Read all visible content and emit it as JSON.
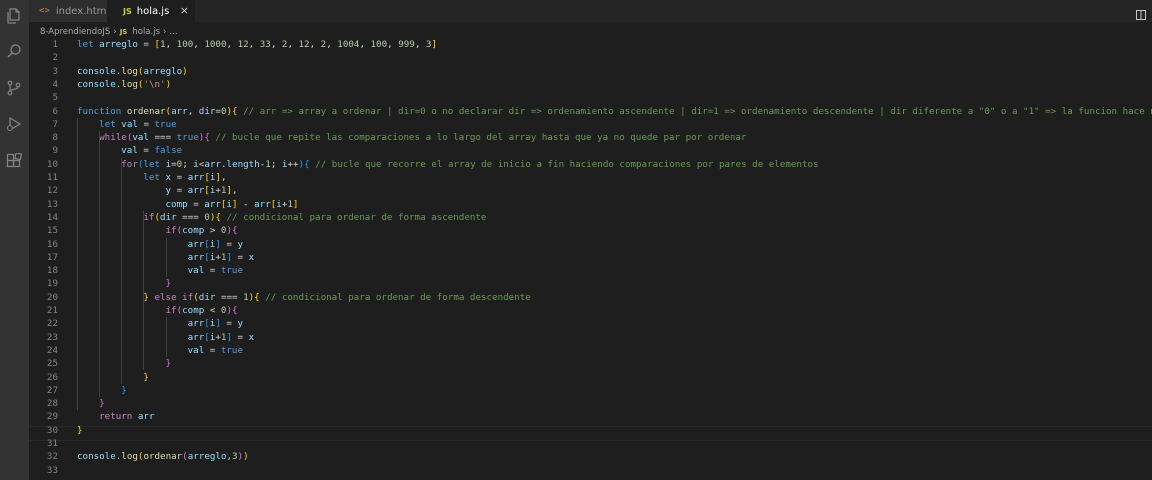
{
  "tabs": [
    {
      "label": "index.html",
      "icon": "html-file-icon"
    },
    {
      "label": "hola.js",
      "icon": "js-file-icon",
      "close": "×"
    }
  ],
  "breadcrumb": {
    "folder": "8-AprendiendoJS",
    "file": "hola.js",
    "symbol": "..."
  },
  "icon_glyphs": {
    "html": "<>",
    "js": "JS"
  },
  "colors": {
    "keyword": "#569cd6",
    "control": "#c586c0",
    "function": "#dcdcaa",
    "variable": "#9cdcfe",
    "number": "#b5cea8",
    "string": "#ce9178",
    "comment": "#6a9955",
    "editor_bg": "#1e1e1e",
    "activity_bg": "#333333"
  },
  "editor": {
    "line_numbers": [
      "1",
      "2",
      "3",
      "4",
      "5",
      "6",
      "7",
      "8",
      "9",
      "10",
      "11",
      "12",
      "13",
      "14",
      "15",
      "16",
      "17",
      "18",
      "19",
      "20",
      "21",
      "22",
      "23",
      "24",
      "25",
      "26",
      "27",
      "28",
      "29",
      "30",
      "31",
      "32",
      "33"
    ],
    "lines": [
      [
        [
          "k",
          "let"
        ],
        [
          "p",
          " "
        ],
        [
          "v",
          "arreglo"
        ],
        [
          "p",
          " = "
        ],
        [
          "b1",
          "["
        ],
        [
          "n",
          "1"
        ],
        [
          "p",
          ", "
        ],
        [
          "n",
          "100"
        ],
        [
          "p",
          ", "
        ],
        [
          "n",
          "1000"
        ],
        [
          "p",
          ", "
        ],
        [
          "n",
          "12"
        ],
        [
          "p",
          ", "
        ],
        [
          "n",
          "33"
        ],
        [
          "p",
          ", "
        ],
        [
          "n",
          "2"
        ],
        [
          "p",
          ", "
        ],
        [
          "n",
          "12"
        ],
        [
          "p",
          ", "
        ],
        [
          "n",
          "2"
        ],
        [
          "p",
          ", "
        ],
        [
          "n",
          "1004"
        ],
        [
          "p",
          ", "
        ],
        [
          "n",
          "100"
        ],
        [
          "p",
          ", "
        ],
        [
          "n",
          "999"
        ],
        [
          "p",
          ", "
        ],
        [
          "n",
          "3"
        ],
        [
          "b1",
          "]"
        ]
      ],
      [],
      [
        [
          "v",
          "console"
        ],
        [
          "p",
          "."
        ],
        [
          "f",
          "log"
        ],
        [
          "b1",
          "("
        ],
        [
          "v",
          "arreglo"
        ],
        [
          "b1",
          ")"
        ]
      ],
      [
        [
          "v",
          "console"
        ],
        [
          "p",
          "."
        ],
        [
          "f",
          "log"
        ],
        [
          "b1",
          "("
        ],
        [
          "s",
          "'\\n'"
        ],
        [
          "b1",
          ")"
        ]
      ],
      [],
      [
        [
          "k",
          "function"
        ],
        [
          "p",
          " "
        ],
        [
          "f",
          "ordenar"
        ],
        [
          "b1",
          "("
        ],
        [
          "v",
          "arr"
        ],
        [
          "p",
          ", "
        ],
        [
          "v",
          "dir"
        ],
        [
          "p",
          "="
        ],
        [
          "n",
          "0"
        ],
        [
          "b1",
          ")"
        ],
        [
          "b1",
          "{"
        ],
        [
          "p",
          " "
        ],
        [
          "m",
          "// arr => array a ordenar | dir=0 o no declarar dir => ordenamiento ascendente | dir=1 => ordenamiento descendente | dir diferente a \"0\" o a \"1\" => la funcion hace nada"
        ]
      ],
      [
        [
          "p",
          "    "
        ],
        [
          "k",
          "let"
        ],
        [
          "p",
          " "
        ],
        [
          "v",
          "val"
        ],
        [
          "p",
          " = "
        ],
        [
          "k",
          "true"
        ]
      ],
      [
        [
          "p",
          "    "
        ],
        [
          "c",
          "while"
        ],
        [
          "b2",
          "("
        ],
        [
          "v",
          "val"
        ],
        [
          "p",
          " === "
        ],
        [
          "k",
          "true"
        ],
        [
          "b2",
          ")"
        ],
        [
          "b2",
          "{"
        ],
        [
          "p",
          " "
        ],
        [
          "m",
          "// bucle que repite las comparaciones a lo largo del array hasta que ya no quede par por ordenar"
        ]
      ],
      [
        [
          "p",
          "        "
        ],
        [
          "v",
          "val"
        ],
        [
          "p",
          " = "
        ],
        [
          "k",
          "false"
        ]
      ],
      [
        [
          "p",
          "        "
        ],
        [
          "c",
          "for"
        ],
        [
          "b3",
          "("
        ],
        [
          "k",
          "let"
        ],
        [
          "p",
          " "
        ],
        [
          "v",
          "i"
        ],
        [
          "p",
          "="
        ],
        [
          "n",
          "0"
        ],
        [
          "p",
          "; "
        ],
        [
          "v",
          "i"
        ],
        [
          "p",
          "<"
        ],
        [
          "v",
          "arr"
        ],
        [
          "p",
          "."
        ],
        [
          "v",
          "length"
        ],
        [
          "p",
          "-"
        ],
        [
          "n",
          "1"
        ],
        [
          "p",
          "; "
        ],
        [
          "v",
          "i"
        ],
        [
          "p",
          "++"
        ],
        [
          "b3",
          ")"
        ],
        [
          "b3",
          "{"
        ],
        [
          "p",
          " "
        ],
        [
          "m",
          "// bucle que recorre el array de inicio a fin haciendo comparaciones por pares de elementos"
        ]
      ],
      [
        [
          "p",
          "            "
        ],
        [
          "k",
          "let"
        ],
        [
          "p",
          " "
        ],
        [
          "v",
          "x"
        ],
        [
          "p",
          " = "
        ],
        [
          "v",
          "arr"
        ],
        [
          "b1",
          "["
        ],
        [
          "v",
          "i"
        ],
        [
          "b1",
          "]"
        ],
        [
          "p",
          ","
        ]
      ],
      [
        [
          "p",
          "                "
        ],
        [
          "v",
          "y"
        ],
        [
          "p",
          " = "
        ],
        [
          "v",
          "arr"
        ],
        [
          "b1",
          "["
        ],
        [
          "v",
          "i"
        ],
        [
          "p",
          "+"
        ],
        [
          "n",
          "1"
        ],
        [
          "b1",
          "]"
        ],
        [
          "p",
          ","
        ]
      ],
      [
        [
          "p",
          "                "
        ],
        [
          "v",
          "comp"
        ],
        [
          "p",
          " = "
        ],
        [
          "v",
          "arr"
        ],
        [
          "b1",
          "["
        ],
        [
          "v",
          "i"
        ],
        [
          "b1",
          "]"
        ],
        [
          "p",
          " - "
        ],
        [
          "v",
          "arr"
        ],
        [
          "b1",
          "["
        ],
        [
          "v",
          "i"
        ],
        [
          "p",
          "+"
        ],
        [
          "n",
          "1"
        ],
        [
          "b1",
          "]"
        ]
      ],
      [
        [
          "p",
          "            "
        ],
        [
          "c",
          "if"
        ],
        [
          "b1",
          "("
        ],
        [
          "v",
          "dir"
        ],
        [
          "p",
          " === "
        ],
        [
          "n",
          "0"
        ],
        [
          "b1",
          ")"
        ],
        [
          "b1",
          "{"
        ],
        [
          "p",
          " "
        ],
        [
          "m",
          "// condicional para ordenar de forma ascendente"
        ]
      ],
      [
        [
          "p",
          "                "
        ],
        [
          "c",
          "if"
        ],
        [
          "b2",
          "("
        ],
        [
          "v",
          "comp"
        ],
        [
          "p",
          " > "
        ],
        [
          "n",
          "0"
        ],
        [
          "b2",
          ")"
        ],
        [
          "b2",
          "{"
        ]
      ],
      [
        [
          "p",
          "                    "
        ],
        [
          "v",
          "arr"
        ],
        [
          "b3",
          "["
        ],
        [
          "v",
          "i"
        ],
        [
          "b3",
          "]"
        ],
        [
          "p",
          " = "
        ],
        [
          "v",
          "y"
        ]
      ],
      [
        [
          "p",
          "                    "
        ],
        [
          "v",
          "arr"
        ],
        [
          "b3",
          "["
        ],
        [
          "v",
          "i"
        ],
        [
          "p",
          "+"
        ],
        [
          "n",
          "1"
        ],
        [
          "b3",
          "]"
        ],
        [
          "p",
          " = "
        ],
        [
          "v",
          "x"
        ]
      ],
      [
        [
          "p",
          "                    "
        ],
        [
          "v",
          "val"
        ],
        [
          "p",
          " = "
        ],
        [
          "k",
          "true"
        ]
      ],
      [
        [
          "p",
          "                "
        ],
        [
          "b2",
          "}"
        ]
      ],
      [
        [
          "p",
          "            "
        ],
        [
          "b1",
          "}"
        ],
        [
          "p",
          " "
        ],
        [
          "c",
          "else"
        ],
        [
          "p",
          " "
        ],
        [
          "c",
          "if"
        ],
        [
          "b1",
          "("
        ],
        [
          "v",
          "dir"
        ],
        [
          "p",
          " === "
        ],
        [
          "n",
          "1"
        ],
        [
          "b1",
          ")"
        ],
        [
          "b1",
          "{"
        ],
        [
          "p",
          " "
        ],
        [
          "m",
          "// condicional para ordenar de forma descendente"
        ]
      ],
      [
        [
          "p",
          "                "
        ],
        [
          "c",
          "if"
        ],
        [
          "b2",
          "("
        ],
        [
          "v",
          "comp"
        ],
        [
          "p",
          " < "
        ],
        [
          "n",
          "0"
        ],
        [
          "b2",
          ")"
        ],
        [
          "b2",
          "{"
        ]
      ],
      [
        [
          "p",
          "                    "
        ],
        [
          "v",
          "arr"
        ],
        [
          "b3",
          "["
        ],
        [
          "v",
          "i"
        ],
        [
          "b3",
          "]"
        ],
        [
          "p",
          " = "
        ],
        [
          "v",
          "y"
        ]
      ],
      [
        [
          "p",
          "                    "
        ],
        [
          "v",
          "arr"
        ],
        [
          "b3",
          "["
        ],
        [
          "v",
          "i"
        ],
        [
          "p",
          "+"
        ],
        [
          "n",
          "1"
        ],
        [
          "b3",
          "]"
        ],
        [
          "p",
          " = "
        ],
        [
          "v",
          "x"
        ]
      ],
      [
        [
          "p",
          "                    "
        ],
        [
          "v",
          "val"
        ],
        [
          "p",
          " = "
        ],
        [
          "k",
          "true"
        ]
      ],
      [
        [
          "p",
          "                "
        ],
        [
          "b2",
          "}"
        ]
      ],
      [
        [
          "p",
          "            "
        ],
        [
          "b1",
          "}"
        ]
      ],
      [
        [
          "p",
          "        "
        ],
        [
          "b3",
          "}"
        ]
      ],
      [
        [
          "p",
          "    "
        ],
        [
          "b2",
          "}"
        ]
      ],
      [
        [
          "p",
          "    "
        ],
        [
          "c",
          "return"
        ],
        [
          "p",
          " "
        ],
        [
          "v",
          "arr"
        ]
      ],
      [
        [
          "b1",
          "}"
        ]
      ],
      [],
      [
        [
          "v",
          "console"
        ],
        [
          "p",
          "."
        ],
        [
          "f",
          "log"
        ],
        [
          "b1",
          "("
        ],
        [
          "f",
          "ordenar"
        ],
        [
          "b2",
          "("
        ],
        [
          "v",
          "arreglo"
        ],
        [
          "p",
          ","
        ],
        [
          "n",
          "3"
        ],
        [
          "b2",
          ")"
        ],
        [
          "b1",
          ")"
        ]
      ],
      []
    ]
  }
}
